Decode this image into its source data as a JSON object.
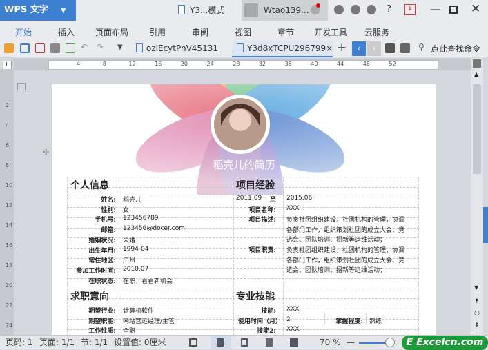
{
  "titlebar": {
    "app": "WPS 文字",
    "doc_title": "Y3...模式",
    "user": "Wtao139..."
  },
  "menu": [
    "开始",
    "插入",
    "页面布局",
    "引用",
    "审阅",
    "视图",
    "章节",
    "开发工具",
    "云服务"
  ],
  "tabs": [
    {
      "label": "oziEcytPnV45131",
      "close": "×"
    },
    {
      "label": "Y3d8xTCPU296799",
      "close": "×"
    }
  ],
  "search": "点此查找命令",
  "ruler_h": [
    "4",
    "8",
    "12",
    "16",
    "20",
    "24",
    "28",
    "32",
    "36",
    "40",
    "44",
    "48",
    "52"
  ],
  "ruler_v": [
    "2",
    "4",
    "6",
    "8",
    "10",
    "12",
    "14",
    "16",
    "18",
    "20",
    "22",
    "24"
  ],
  "resume": {
    "title": "稻壳儿的简历",
    "personal": {
      "heading": "个人信息",
      "rows": [
        [
          "姓名:",
          "稻壳儿"
        ],
        [
          "性别:",
          "女"
        ],
        [
          "手机号:",
          "123456789"
        ],
        [
          "邮箱:",
          "123456@docer.com"
        ],
        [
          "婚姻状况:",
          "未婚"
        ],
        [
          "出生年月:",
          "1994-04"
        ],
        [
          "常住地区:",
          "广州"
        ],
        [
          "参加工作时间:",
          "2010.07"
        ],
        [
          "在职状态:",
          "在职，看看新机会"
        ]
      ]
    },
    "intent": {
      "heading": "求职意向",
      "rows": [
        [
          "期望行业:",
          "计算机软件"
        ],
        [
          "期望职能:",
          "网站营运经理/主管"
        ],
        [
          "工作性质:",
          "全职"
        ]
      ]
    },
    "project": {
      "heading": "项目经验",
      "start": "2011.09",
      "to": "至",
      "end": "2015.06",
      "name_label": "项目名称:",
      "name": "XXX",
      "desc_label": "项目描述:",
      "desc": [
        "负责社团组织建设，社团机构的管理，协调",
        "各部门工作，组织策划社团的成立大会、竞",
        "选会、团队培训、招新等运维活动；"
      ],
      "duty_label": "项目职责:",
      "duty": [
        "负责社团组织建设，社团机构的管理，协调",
        "各部门工作，组织策划社团的成立大会、竞",
        "选会、团队培训、招新等运维活动；"
      ]
    },
    "skills": {
      "heading": "专业技能",
      "skill_label": "技能:",
      "skill": "XXX",
      "time_label": "使用时间（月）",
      "time": "2",
      "level_label": "掌握程度:",
      "level": "熟练",
      "skill2_label": "技能2:",
      "skill2": "XXX"
    }
  },
  "status": {
    "page": "页码: 1",
    "pages": "页面: 1/1",
    "section": "节: 1/1",
    "setting": "设置值: 0厘米",
    "zoom": "70 %",
    "watermark": "Excelcn.com"
  },
  "colors": {
    "accent": "#3d7fd1",
    "watermark": "#1f9a3a"
  }
}
